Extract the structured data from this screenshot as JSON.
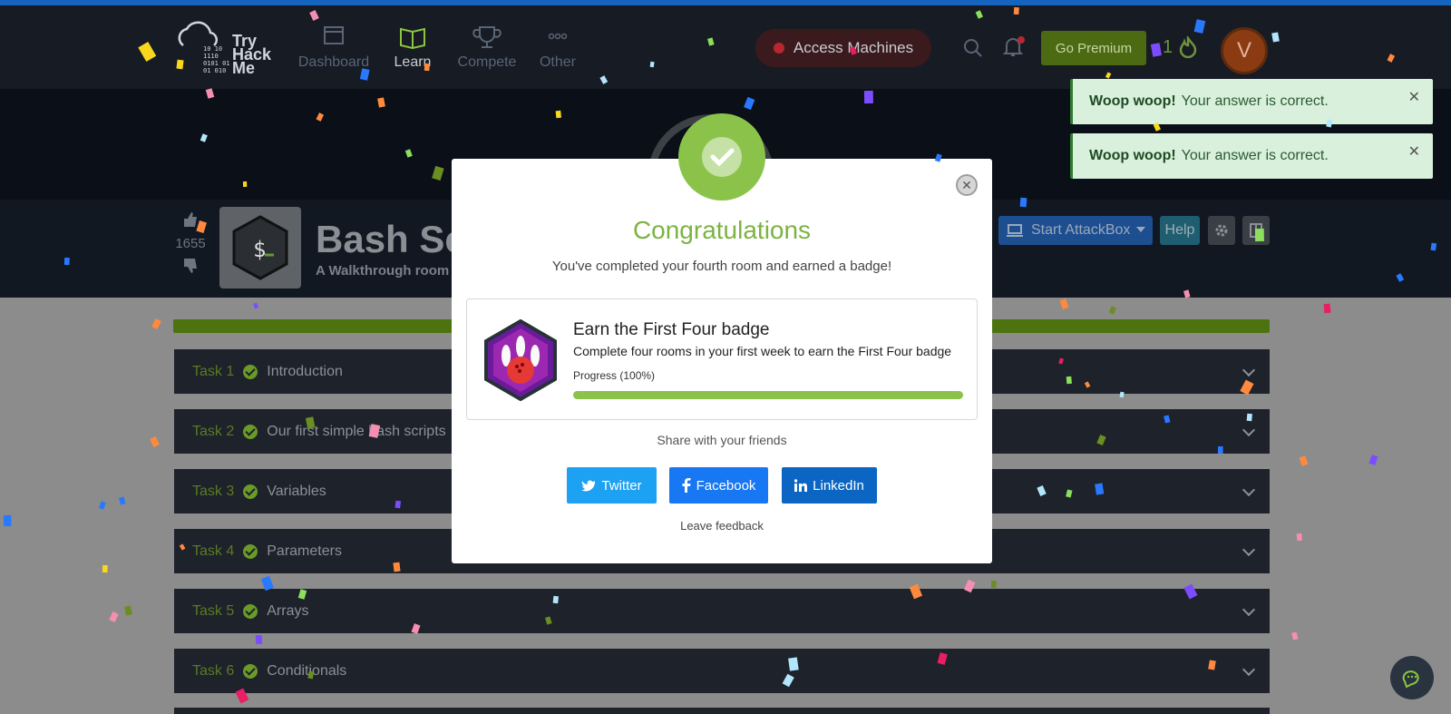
{
  "nav": {
    "logo_text": "Try\nHack\nMe",
    "logo_binary": "10 10\n1110\n0101 01\n01 010",
    "items": [
      {
        "label": "Dashboard",
        "icon": "dashboard-icon"
      },
      {
        "label": "Learn",
        "icon": "book-icon",
        "active": true
      },
      {
        "label": "Compete",
        "icon": "trophy-icon"
      },
      {
        "label": "Other",
        "icon": "more-icon"
      }
    ],
    "access_label": "Access Machines",
    "premium_label": "Go Premium",
    "streak": "1",
    "avatar_initial": "V"
  },
  "room": {
    "votes": "1655",
    "title": "Bash Scr",
    "subtitle": "A Walkthrough room",
    "attackbox_label": "Start AttackBox",
    "help_label": "Help"
  },
  "tasks": [
    {
      "num": "Task 1",
      "title": "Introduction"
    },
    {
      "num": "Task 2",
      "title": "Our first simple bash scripts"
    },
    {
      "num": "Task 3",
      "title": "Variables"
    },
    {
      "num": "Task 4",
      "title": "Parameters"
    },
    {
      "num": "Task 5",
      "title": "Arrays"
    },
    {
      "num": "Task 6",
      "title": "Conditionals"
    }
  ],
  "toasts": [
    {
      "strong": "Woop woop!",
      "text": "Your answer is correct."
    },
    {
      "strong": "Woop woop!",
      "text": "Your answer is correct."
    }
  ],
  "modal": {
    "title": "Congratulations",
    "subtitle": "You've completed your fourth room and earned a badge!",
    "badge_name": "Earn the First Four badge",
    "badge_desc": "Complete four rooms in your first week to earn the First Four badge",
    "progress_label": "Progress (100%)",
    "progress_value": 1.0,
    "share_label": "Share with your friends",
    "twitter_label": "Twitter",
    "facebook_label": "Facebook",
    "linkedin_label": "LinkedIn",
    "feedback_label": "Leave feedback"
  },
  "colors": {
    "accent_green": "#8bc34a",
    "navbar_bg": "#161b24",
    "twitter": "#1da1f2",
    "facebook": "#1877f2",
    "linkedin": "#0a66c2"
  }
}
